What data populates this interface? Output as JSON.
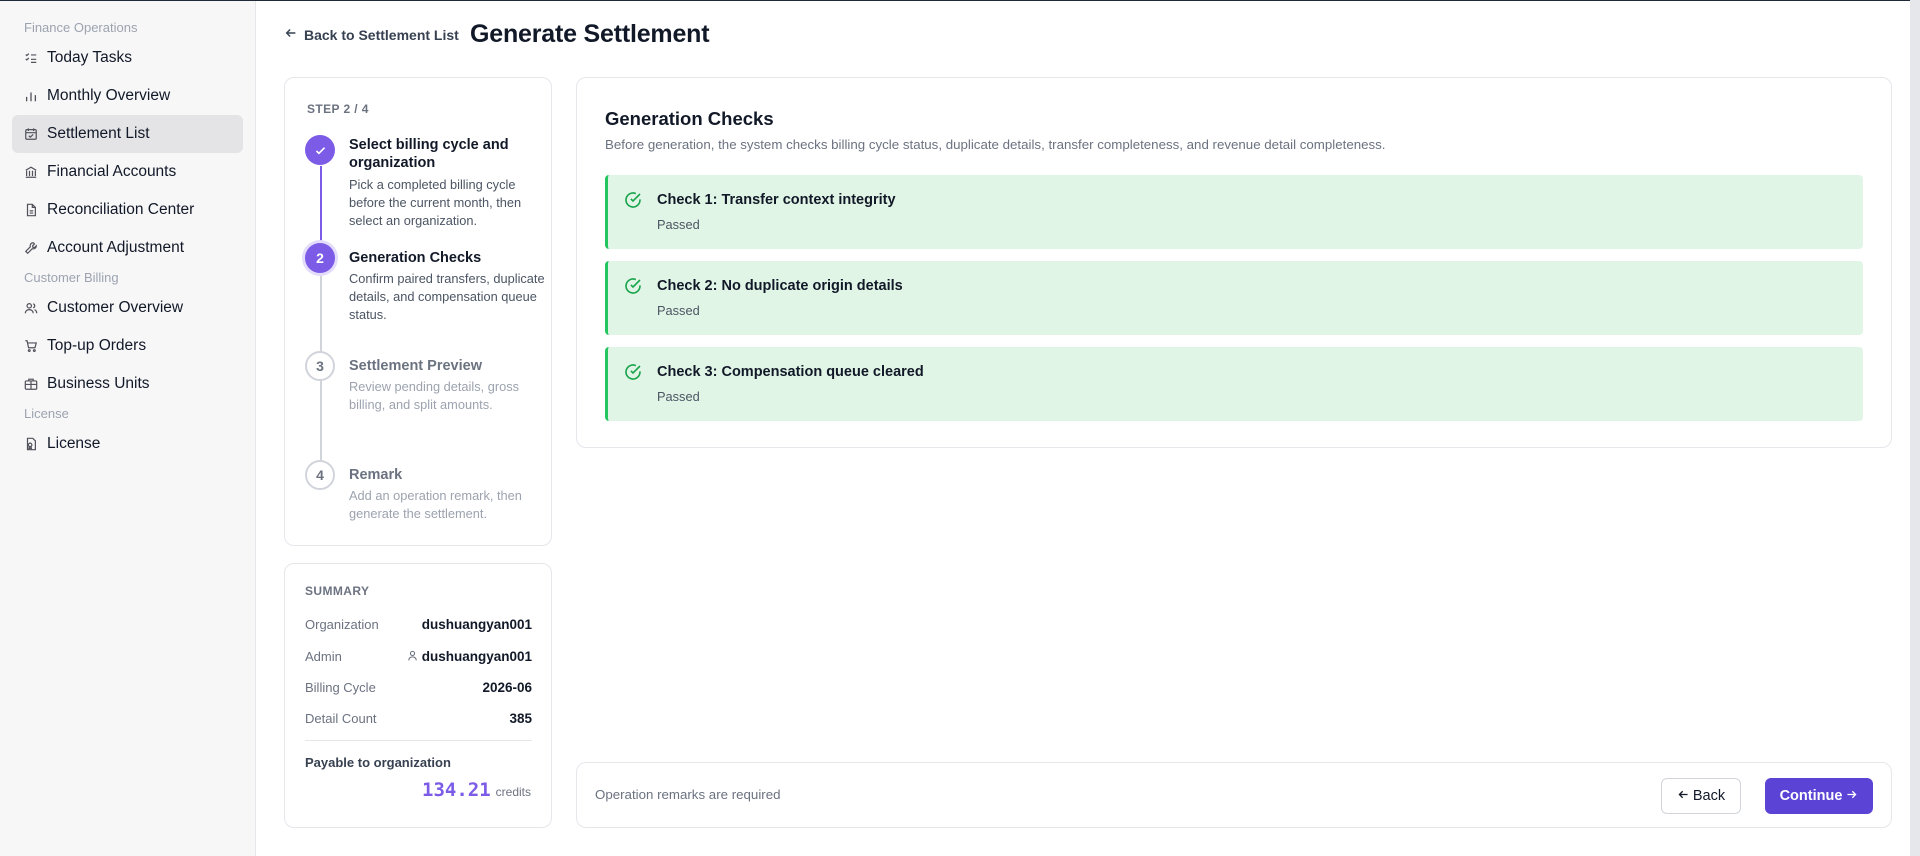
{
  "sidebar": {
    "groups": [
      {
        "label": "Finance Operations",
        "items": [
          {
            "label": "Today Tasks",
            "icon": "list-check-icon"
          },
          {
            "label": "Monthly Overview",
            "icon": "bar-chart-icon"
          },
          {
            "label": "Settlement List",
            "icon": "calendar-check-icon",
            "active": true
          },
          {
            "label": "Financial Accounts",
            "icon": "bank-icon"
          },
          {
            "label": "Reconciliation Center",
            "icon": "document-icon"
          },
          {
            "label": "Account Adjustment",
            "icon": "wrench-icon"
          }
        ]
      },
      {
        "label": "Customer Billing",
        "items": [
          {
            "label": "Customer Overview",
            "icon": "users-icon"
          },
          {
            "label": "Top-up Orders",
            "icon": "cart-icon"
          },
          {
            "label": "Business Units",
            "icon": "briefcase-icon"
          }
        ]
      },
      {
        "label": "License",
        "items": [
          {
            "label": "License",
            "icon": "license-icon"
          }
        ]
      }
    ]
  },
  "header": {
    "back_label": "Back to Settlement List",
    "title": "Generate Settlement"
  },
  "steps": {
    "header": "STEP 2 / 4",
    "items": [
      {
        "number": "1",
        "state": "done",
        "title": "Select billing cycle and organization",
        "desc": "Pick a completed billing cycle before the current month, then select an organization."
      },
      {
        "number": "2",
        "state": "current",
        "title": "Generation Checks",
        "desc": "Confirm paired transfers, duplicate details, and compensation queue status."
      },
      {
        "number": "3",
        "state": "todo",
        "title": "Settlement Preview",
        "desc": "Review pending details, gross billing, and split amounts."
      },
      {
        "number": "4",
        "state": "todo",
        "title": "Remark",
        "desc": "Add an operation remark, then generate the settlement."
      }
    ]
  },
  "summary": {
    "header": "SUMMARY",
    "organization_label": "Organization",
    "organization_value": "dushuangyan001",
    "admin_label": "Admin",
    "admin_value": "dushuangyan001",
    "billing_cycle_label": "Billing Cycle",
    "billing_cycle_value": "2026-06",
    "detail_count_label": "Detail Count",
    "detail_count_value": "385",
    "payable_label": "Payable to organization",
    "payable_amount": "134.21",
    "payable_unit": "credits"
  },
  "checks": {
    "title": "Generation Checks",
    "subtitle": "Before generation, the system checks billing cycle status, duplicate details, transfer completeness, and revenue detail completeness.",
    "items": [
      {
        "title": "Check 1: Transfer context integrity",
        "status": "Passed"
      },
      {
        "title": "Check 2: No duplicate origin details",
        "status": "Passed"
      },
      {
        "title": "Check 3: Compensation queue cleared",
        "status": "Passed"
      }
    ]
  },
  "footer": {
    "note": "Operation remarks are required",
    "back_label": "Back",
    "continue_label": "Continue"
  },
  "colors": {
    "accent": "#7c5ce6",
    "primary_button": "#5b43d6",
    "check_bg": "#e1f5e6",
    "check_border": "#22c55e"
  }
}
